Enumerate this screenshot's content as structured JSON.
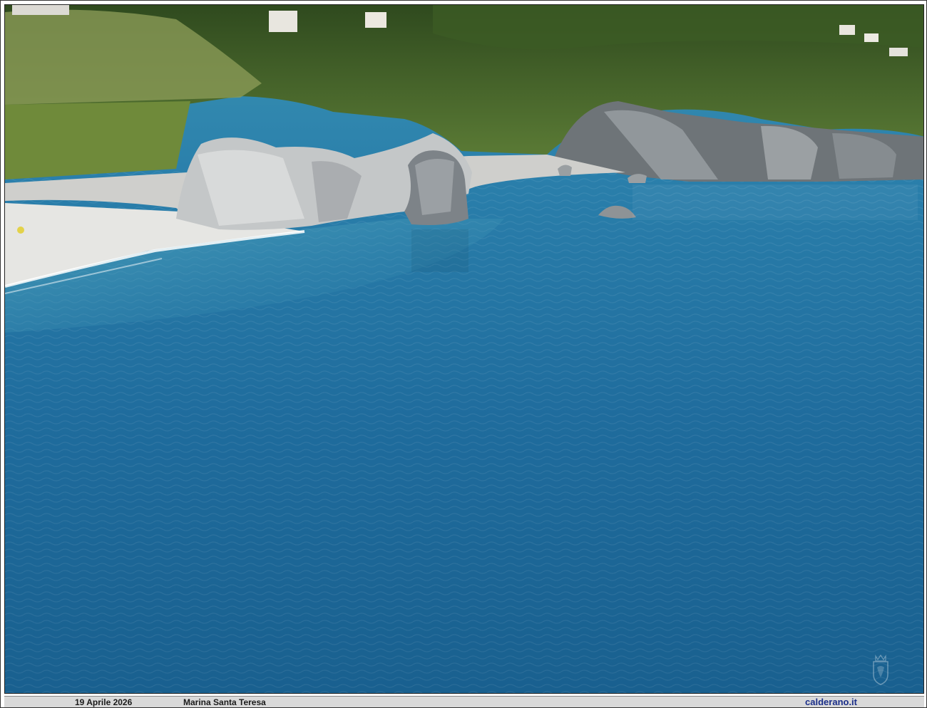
{
  "photo": {
    "subject": "aerial-sea-coast-photo"
  },
  "caption": {
    "date": "19 Aprile 2026",
    "place": "Marina Santa Teresa",
    "site": "calderano.it"
  },
  "colors": {
    "sea_deep": "#1f6a99",
    "sea_shallow": "#3f9bb8",
    "sand": "#e6e6e3",
    "rock": "#bfc2c4",
    "vegetation": "#4f6f2e",
    "caption_bar": "#d9d9d9",
    "site_link": "#1b2f8a"
  }
}
